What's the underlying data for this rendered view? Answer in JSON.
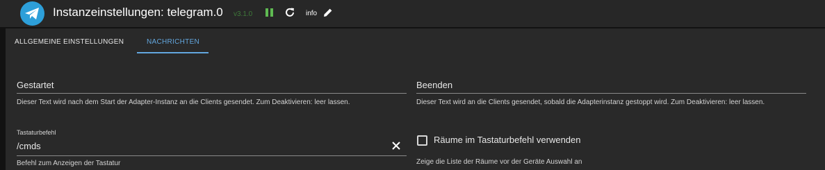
{
  "header": {
    "title": "Instanzeinstellungen: telegram.0",
    "version": "v3.1.0",
    "info_label": "info",
    "colors": {
      "logo": "#2d9fd9",
      "running": "#5fba52",
      "accent": "#63a7df"
    }
  },
  "tabs": [
    {
      "label": "ALLGEMEINE EINSTELLUNGEN",
      "active": false
    },
    {
      "label": "NACHRICHTEN",
      "active": true
    }
  ],
  "fields": {
    "started": {
      "value": "Gestartet",
      "helper": "Dieser Text wird nach dem Start der Adapter-Instanz an die Clients gesendet. Zum Deaktivieren: leer lassen."
    },
    "stopped": {
      "value": "Beenden",
      "helper": "Dieser Text wird an die Clients gesendet, sobald die Adapterinstanz gestoppt wird. Zum Deaktivieren: leer lassen."
    },
    "keyboard_command": {
      "label": "Tastaturbefehl",
      "value": "/cmds",
      "helper": "Befehl zum Anzeigen der Tastatur"
    },
    "rooms_in_keyboard": {
      "label": "Räume im Tastaturbefehl verwenden",
      "checked": false,
      "helper": "Zeige die Liste der Räume vor der Geräte Auswahl an"
    }
  }
}
